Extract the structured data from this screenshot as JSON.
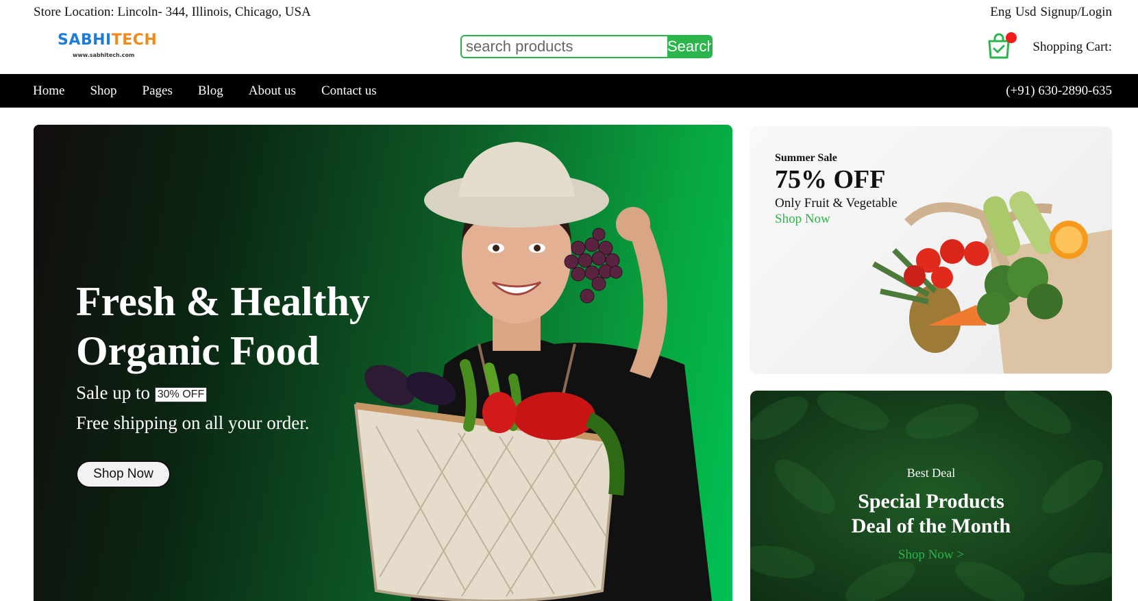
{
  "topbar": {
    "store_location": "Store Location: Lincoln- 344, Illinois, Chicago, USA",
    "lang": "Eng",
    "currency": "Usd",
    "auth": "Signup/Login"
  },
  "logo": {
    "part1": "SABHI",
    "part2": "TECH",
    "url": "www.sabhitech.com"
  },
  "search": {
    "placeholder": "search products",
    "button": "Search"
  },
  "cart": {
    "label": "Shopping Cart:",
    "icon": "shopping-bag-icon",
    "dot_color": "#f21b1b"
  },
  "nav": {
    "items": [
      "Home",
      "Shop",
      "Pages",
      "Blog",
      "About us",
      "Contact us"
    ],
    "phone": "(+91) 630-2890-635"
  },
  "hero": {
    "title_line1": "Fresh & Healthy",
    "title_line2": "Organic Food",
    "sale_prefix": "Sale up to",
    "sale_badge": "30% OFF",
    "shipping": "Free shipping on all your order.",
    "button": "Shop Now"
  },
  "promo_card": {
    "label": "Summer Sale",
    "discount": "75% OFF",
    "subtitle": "Only Fruit & Vegetable",
    "link": "Shop Now"
  },
  "deal_card": {
    "label": "Best Deal",
    "title_line1": "Special Products",
    "title_line2": "Deal of the Month",
    "link": "Shop Now >"
  },
  "colors": {
    "accent_green": "#2cb54c",
    "nav_bg": "#000000",
    "logo_blue": "#1f7bd8",
    "logo_orange": "#f08a1a"
  }
}
